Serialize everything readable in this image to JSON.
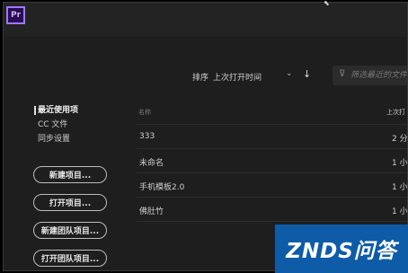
{
  "app": {
    "logo_text": "Pr"
  },
  "sort": {
    "label": "排序",
    "value": "上次打开时间",
    "chevron": "⌄",
    "direction_icon": "arrow-down-icon",
    "direction_glyph": "↓"
  },
  "filter": {
    "icon": "filter-icon",
    "glyph": "⊽",
    "placeholder": "筛选最近的文件"
  },
  "sidebar": {
    "items": [
      {
        "label": "最近使用项",
        "active": true
      },
      {
        "label": "CC 文件",
        "active": false
      },
      {
        "label": "同步设置",
        "active": false
      }
    ]
  },
  "buttons": {
    "new_project": "新建项目...",
    "open_project": "打开项目...",
    "new_team_project": "新建团队项目...",
    "open_team_project": "打开团队项目..."
  },
  "table": {
    "columns": {
      "name": "名称",
      "opened": "上次打"
    },
    "rows": [
      {
        "name": "333",
        "opened": "2 分"
      },
      {
        "name": "未命名",
        "opened": "1 小"
      },
      {
        "name": "手机模板2.0",
        "opened": "1 小"
      },
      {
        "name": "佛肚竹",
        "opened": "1 小"
      }
    ]
  },
  "watermark": {
    "text": "ZNDS问答"
  },
  "colors": {
    "background": "#1e1e1e",
    "titlebar": "#232323",
    "accent_logo": "#9a7bff",
    "watermark": "#0e5ba8"
  }
}
